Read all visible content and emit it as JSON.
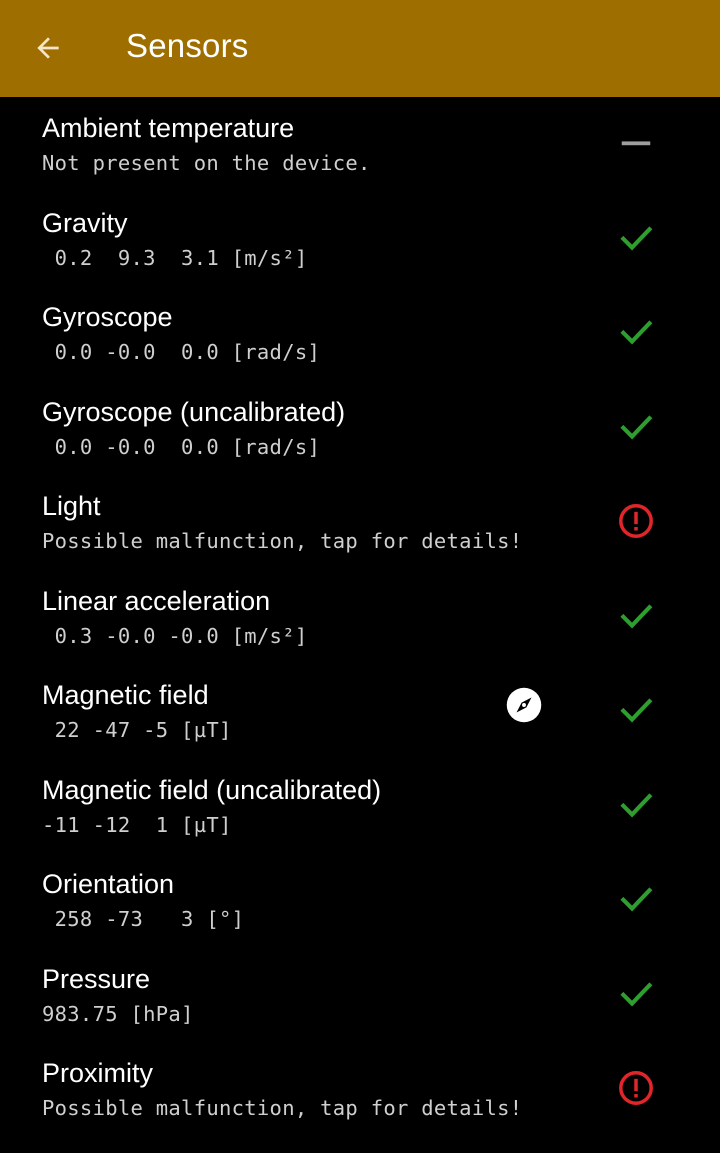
{
  "appbar": {
    "title": "Sensors",
    "back_icon": "arrow-back-icon",
    "color": "#9e6f00"
  },
  "colors": {
    "ok": "#2e9e2e",
    "error": "#e0252b",
    "absent": "#9e9e9e"
  },
  "sensors": [
    {
      "name": "Ambient temperature",
      "detail": "Not present on the device.",
      "status": "absent"
    },
    {
      "name": "Gravity",
      "detail": " 0.2  9.3  3.1 [m/s²]",
      "status": "ok"
    },
    {
      "name": "Gyroscope",
      "detail": " 0.0 -0.0  0.0 [rad/s]",
      "status": "ok"
    },
    {
      "name": "Gyroscope (uncalibrated)",
      "detail": " 0.0 -0.0  0.0 [rad/s]",
      "status": "ok"
    },
    {
      "name": "Light",
      "detail": "Possible malfunction, tap for details!",
      "status": "error"
    },
    {
      "name": "Linear acceleration",
      "detail": " 0.3 -0.0 -0.0 [m/s²]",
      "status": "ok"
    },
    {
      "name": "Magnetic field",
      "detail": " 22 -47 -5 [µT]",
      "status": "ok",
      "extra_icon": "compass-icon"
    },
    {
      "name": "Magnetic field (uncalibrated)",
      "detail": "-11 -12  1 [µT]",
      "status": "ok"
    },
    {
      "name": "Orientation",
      "detail": " 258 -73   3 [°]",
      "status": "ok"
    },
    {
      "name": "Pressure",
      "detail": "983.75 [hPa]",
      "status": "ok"
    },
    {
      "name": "Proximity",
      "detail": "Possible malfunction, tap for details!",
      "status": "error"
    }
  ]
}
